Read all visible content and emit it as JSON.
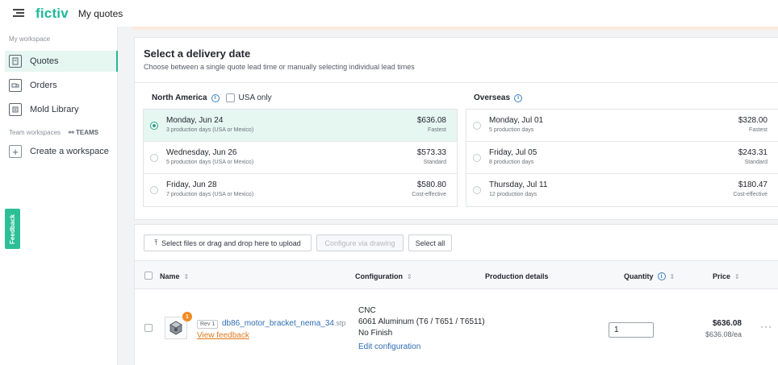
{
  "topbar": {
    "logo": "fictiv",
    "breadcrumb": "My quotes"
  },
  "sidebar": {
    "workspace_label": "My workspace",
    "items": [
      {
        "label": "Quotes",
        "icon": "quotes-icon"
      },
      {
        "label": "Orders",
        "icon": "orders-icon"
      },
      {
        "label": "Mold Library",
        "icon": "mold-library-icon"
      }
    ],
    "team_label": "Team workspaces",
    "team_tag": "TEAMS",
    "create_label": "Create a workspace",
    "feedback_tab": "Feedback"
  },
  "delivery": {
    "title": "Select a delivery date",
    "subtitle": "Choose between a single quote lead time or manually selecting individual lead times",
    "north_america": {
      "heading": "North America",
      "usa_only_label": "USA only",
      "options": [
        {
          "date": "Monday, Jun 24",
          "days": "3 production days (USA or Mexico)",
          "price": "$636.08",
          "tag": "Fastest",
          "selected": true
        },
        {
          "date": "Wednesday, Jun 26",
          "days": "5 production days (USA or Mexico)",
          "price": "$573.33",
          "tag": "Standard",
          "selected": false
        },
        {
          "date": "Friday, Jun 28",
          "days": "7 production days (USA or Mexico)",
          "price": "$580.80",
          "tag": "Cost-effective",
          "selected": false
        }
      ]
    },
    "overseas": {
      "heading": "Overseas",
      "options": [
        {
          "date": "Monday, Jul 01",
          "days": "5 production days",
          "price": "$328.00",
          "tag": "Fastest",
          "selected": false
        },
        {
          "date": "Friday, Jul 05",
          "days": "8 production days",
          "price": "$243.31",
          "tag": "Standard",
          "selected": false
        },
        {
          "date": "Thursday, Jul 11",
          "days": "12 production days",
          "price": "$180.47",
          "tag": "Cost-effective",
          "selected": false
        }
      ]
    }
  },
  "parts": {
    "upload_label": "Select files or drag and drop here to upload",
    "configure_label": "Configure via drawing",
    "select_all_label": "Select all",
    "columns": {
      "name": "Name",
      "configuration": "Configuration",
      "production": "Production details",
      "quantity": "Quantity",
      "price": "Price"
    },
    "rows": [
      {
        "badge": "1",
        "rev": "Rev 1",
        "filename": "db86_motor_bracket_nema_34",
        "ext": ".stp",
        "feedback_link": "View feedback",
        "process": "CNC",
        "material": "6061 Aluminum (T6 / T651 / T6511)",
        "finish": "No Finish",
        "edit_label": "Edit configuration",
        "quantity": "1",
        "price": "$636.08",
        "price_each": "$636.08/ea"
      }
    ]
  },
  "colors": {
    "brand": "#1fb89a",
    "selected_bg": "#e6f6f1",
    "link": "#2f6cb4",
    "warning": "#f28a1f"
  }
}
